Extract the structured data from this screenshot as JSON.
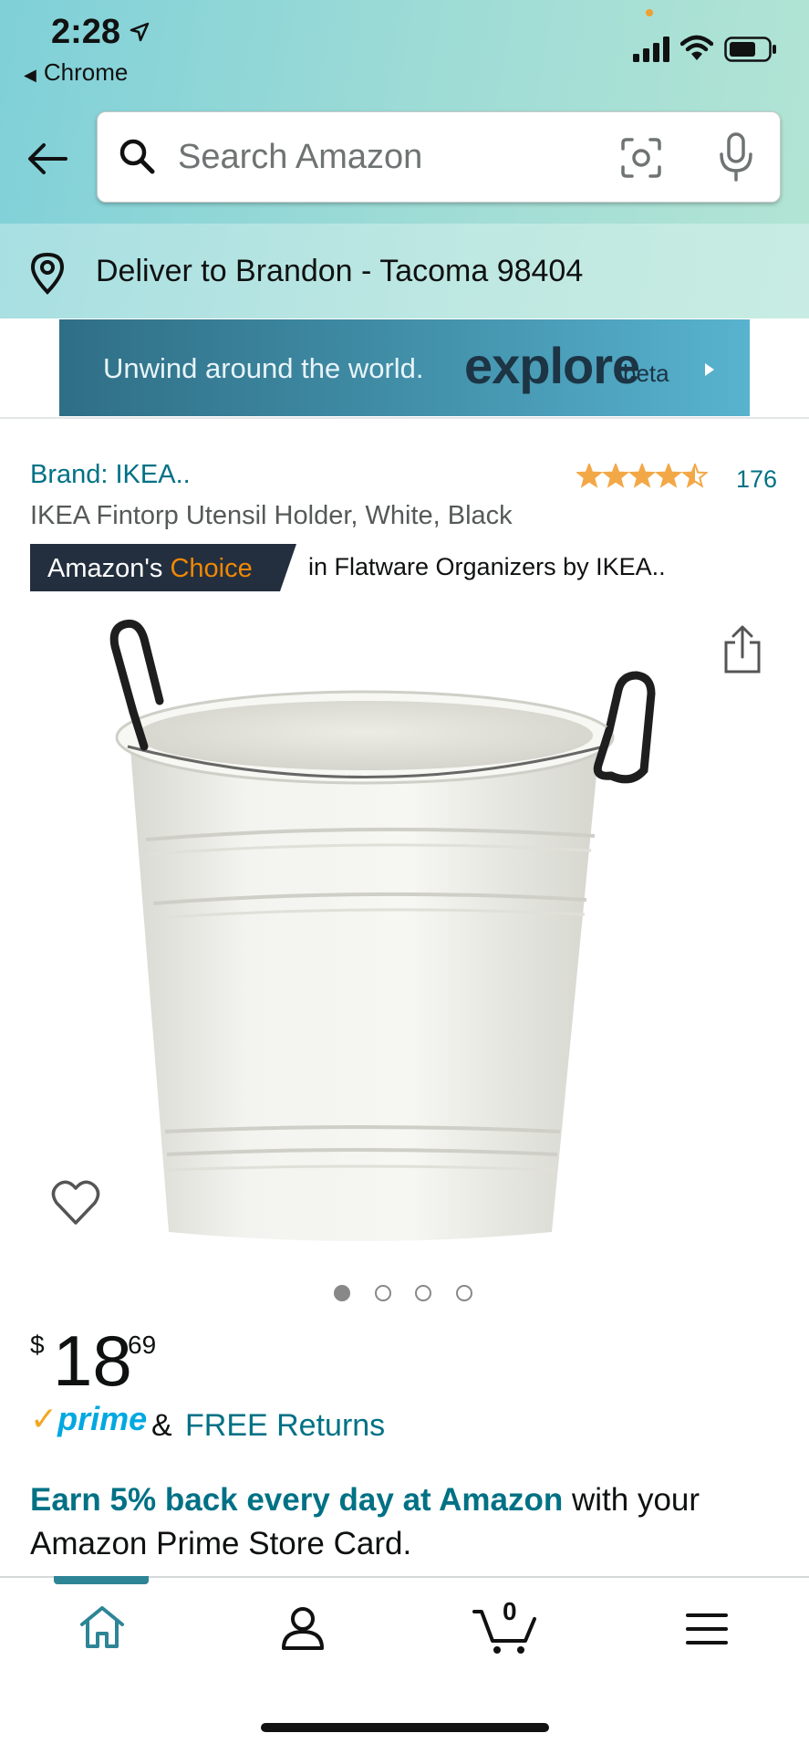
{
  "status_bar": {
    "time": "2:28",
    "back_app": "Chrome"
  },
  "search": {
    "placeholder": "Search Amazon"
  },
  "delivery": {
    "text": "Deliver to Brandon - Tacoma 98404"
  },
  "banner": {
    "tagline": "Unwind around the world.",
    "logo": "explore",
    "badge": "beta"
  },
  "product": {
    "brand": "Brand: IKEA..",
    "rating": 4.5,
    "rating_count": "176",
    "title": "IKEA Fintorp Utensil Holder, White, Black",
    "choice_prefix": "Amazon's",
    "choice_word": "Choice",
    "choice_category": "in Flatware Organizers by IKEA..",
    "image_count": 4,
    "image_index": 1,
    "price_symbol": "$",
    "price_whole": "18",
    "price_fraction": "69",
    "prime_label": "prime",
    "amp": "&",
    "free_returns": "FREE Returns"
  },
  "promo": {
    "highlight": "Earn 5% back every day at Amazon",
    "rest": "with your",
    "line2": "Amazon Prime Store Card."
  },
  "bottom_nav": {
    "cart_count": "0"
  },
  "colors": {
    "link": "#007185",
    "choice_bg": "#232f3e",
    "choice_orange": "#f08804",
    "star": "#f3a847"
  }
}
